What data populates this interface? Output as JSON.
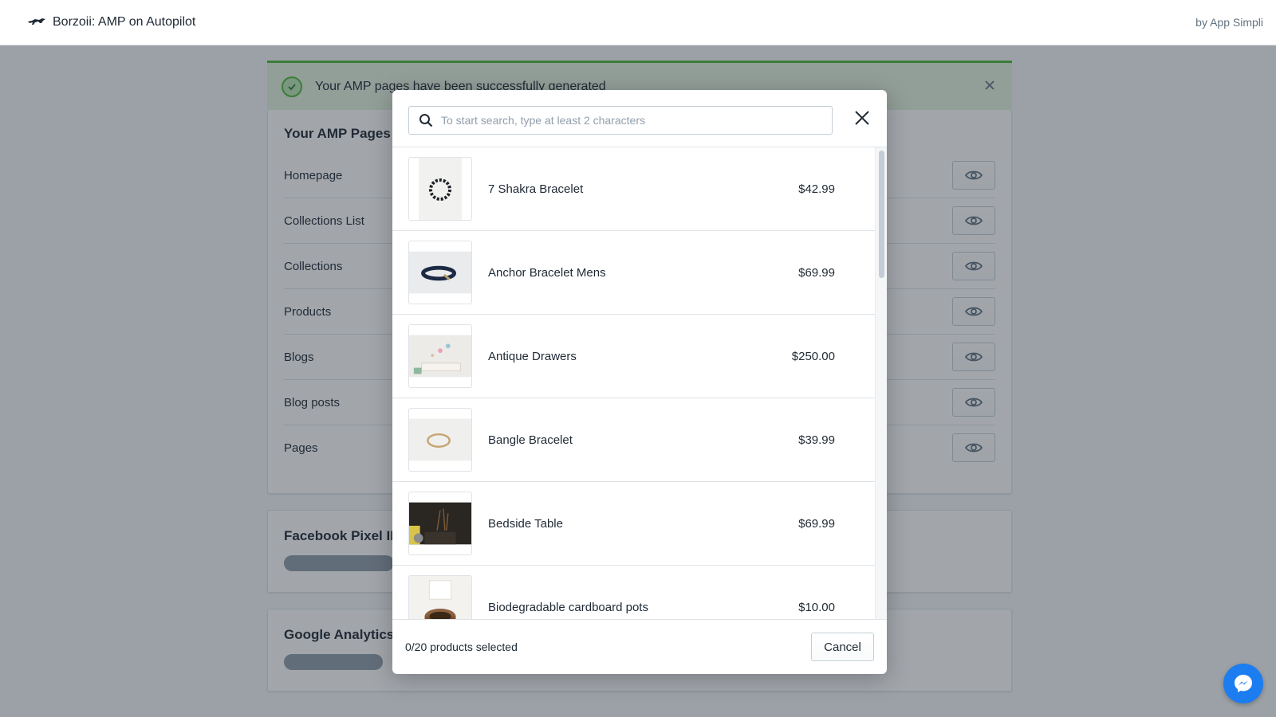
{
  "app": {
    "title": "Borzoii: AMP on Autopilot",
    "byline": "by App Simpli",
    "logo_icon": "borzoi-dog-icon"
  },
  "banner": {
    "message": "Your AMP pages have been successfully generated",
    "icon": "check-circle-icon"
  },
  "amp_pages": {
    "heading": "Your AMP Pages",
    "rows": [
      {
        "label": "Homepage"
      },
      {
        "label": "Collections List"
      },
      {
        "label": "Collections"
      },
      {
        "label": "Products"
      },
      {
        "label": "Blogs"
      },
      {
        "label": "Blog posts"
      },
      {
        "label": "Pages"
      }
    ]
  },
  "facebook": {
    "heading": "Facebook Pixel ID"
  },
  "analytics": {
    "heading": "Google Analytics T"
  },
  "modal": {
    "search_placeholder": "To start search, type at least 2 characters",
    "products": [
      {
        "name": "7 Shakra Bracelet",
        "price": "$42.99"
      },
      {
        "name": "Anchor Bracelet Mens",
        "price": "$69.99"
      },
      {
        "name": "Antique Drawers",
        "price": "$250.00"
      },
      {
        "name": "Bangle Bracelet",
        "price": "$39.99"
      },
      {
        "name": "Bedside Table",
        "price": "$69.99"
      },
      {
        "name": "Biodegradable cardboard pots",
        "price": "$10.00"
      }
    ],
    "selected_count": "0/20 products selected",
    "cancel_label": "Cancel"
  },
  "colors": {
    "success": "#50b83c",
    "messenger": "#1c7df0"
  }
}
